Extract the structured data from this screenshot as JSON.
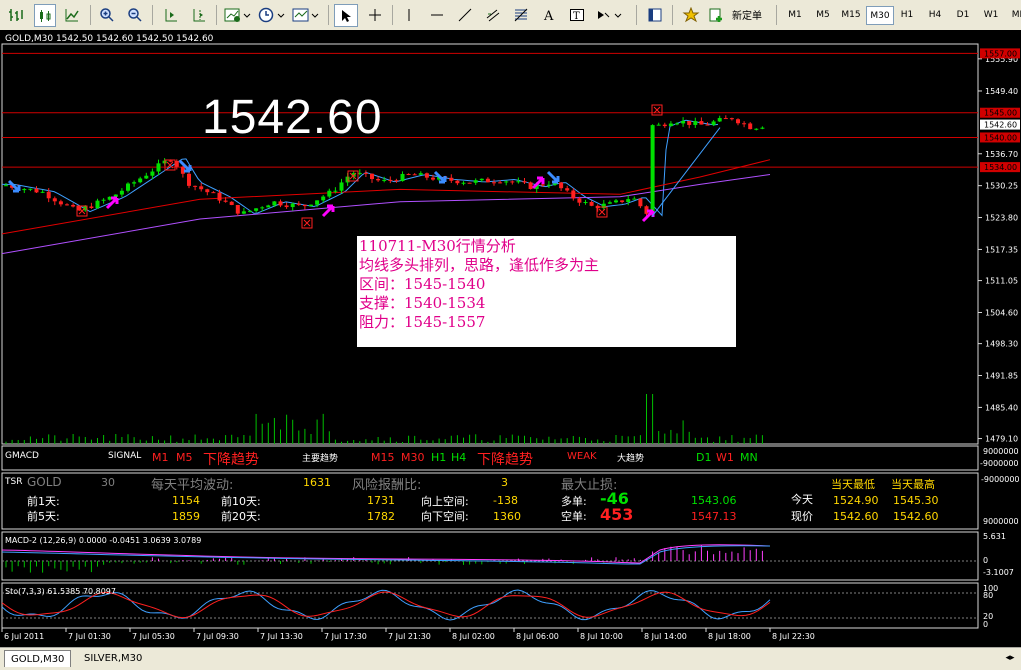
{
  "toolbar": {
    "new_order_label": "新定单",
    "timeframes": [
      "M1",
      "M5",
      "M15",
      "M30",
      "H1",
      "H4",
      "D1",
      "W1",
      "MN"
    ],
    "active_timeframe": "M30"
  },
  "chart": {
    "header": "GOLD,M30  1542.50 1542.60 1542.50 1542.60",
    "big_price": "1542.60",
    "price_ticks": [
      "1555.90",
      "1549.40",
      "1536.70",
      "1530.25",
      "1523.80",
      "1517.35",
      "1511.05",
      "1504.60",
      "1498.30",
      "1491.85",
      "1485.40",
      "1479.10"
    ],
    "right_labels": [
      {
        "text": "1557.00",
        "color": "#e00000"
      },
      {
        "text": "1545.00",
        "color": "#e00000"
      },
      {
        "text": "1542.60",
        "color": "#ffffff"
      },
      {
        "text": "1540.00",
        "color": "#e00000"
      },
      {
        "text": "1534.00",
        "color": "#e00000"
      }
    ],
    "analysis": {
      "title": "110711-M30行情分析",
      "line1": "均线多头排列，思路，逢低作多为主",
      "line2": "区间：1545-1540",
      "line3": "支撑：1540-1534",
      "line4": "阻力：1545-1557"
    }
  },
  "gmacd": {
    "name": "GMACD",
    "signal": "SIGNAL",
    "m1": "M1",
    "m5": "M5",
    "trend1": "下降趋势",
    "main_trend": "主要趋势",
    "m15": "M15",
    "m30": "M30",
    "h1": "H1",
    "h4": "H4",
    "trend2": "下降趋势",
    "weak": "WEAK",
    "big_trend": "大趋势",
    "d1": "D1",
    "w1": "W1",
    "mn": "MN",
    "scale_top": "9000000",
    "scale_bottom": "-9000000"
  },
  "tsr": {
    "name": "TSR",
    "symbol": "GOLD",
    "value": "30",
    "avg_label": "每天平均波动:",
    "avg_value": "1631",
    "risk_label": "风险报酬比:",
    "risk_value": "3",
    "maxloss_label": "最大止损:",
    "prev1_label": "前1天:",
    "prev1_value": "1154",
    "prev10_label": "前10天:",
    "prev10_value": "1731",
    "up_space_label": "向上空间:",
    "up_space_value": "-138",
    "long_label": "多单:",
    "long_value": "-46",
    "long_price": "1543.06",
    "today_label": "今天",
    "today_low": "1524.90",
    "today_high": "1545.30",
    "low_header": "当天最低",
    "high_header": "当天最高",
    "prev5_label": "前5天:",
    "prev5_value": "1859",
    "prev20_label": "前20天:",
    "prev20_value": "1782",
    "down_space_label": "向下空间:",
    "down_space_value": "1360",
    "short_label": "空单:",
    "short_value": "453",
    "short_price": "1547.13",
    "now_label": "现价",
    "now_low": "1542.60",
    "now_high": "1542.60",
    "scale_top": "-9000000",
    "scale_bottom": "9000000"
  },
  "macd": {
    "header": "MACD-2 (12,26,9) 0.0000 -0.0451 3.0639 3.0789",
    "scale_top": "5.631",
    "scale_zero": "0",
    "scale_bottom": "-3.1007"
  },
  "sto": {
    "header": "Sto(7,3,3) 61.5385 70.8097",
    "scale_top": "100",
    "scale_80": "80",
    "scale_20": "20",
    "scale_0": "0"
  },
  "time_axis": [
    "6 Jul 2011",
    "7 Jul 01:30",
    "7 Jul 05:30",
    "7 Jul 09:30",
    "7 Jul 13:30",
    "7 Jul 17:30",
    "7 Jul 21:30",
    "8 Jul 02:00",
    "8 Jul 06:00",
    "8 Jul 10:00",
    "8 Jul 14:00",
    "8 Jul 18:00",
    "8 Jul 22:30"
  ],
  "tabs": [
    "GOLD,M30",
    "SILVER,M30"
  ],
  "colors": {
    "bull": "#00e000",
    "bear": "#ff2020",
    "ma_fast": "#3fa0ff",
    "ma_mid": "#e00000",
    "ma_slow": "#b050ff",
    "arrow_magenta": "#ff00ff",
    "arrow_blue": "#3b8cff"
  }
}
